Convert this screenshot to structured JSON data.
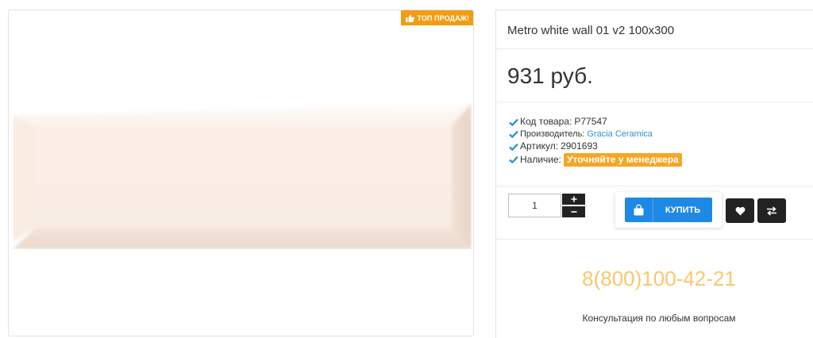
{
  "badge": {
    "label": "ТОП ПРОДАЖ!",
    "icon": "thumbs-up-icon",
    "color": "#f39c12"
  },
  "product": {
    "title": "Metro white wall 01 v2 100x300",
    "price": "931 руб."
  },
  "props": {
    "code_label": "Код товара:",
    "code_value": "P77547",
    "manufacturer_label": "Производитель:",
    "manufacturer_value": "Gracia Ceramica",
    "article_label": "Артикул:",
    "article_value": "2901693",
    "availability_label": "Наличие:",
    "availability_value": "Уточняйте у менеджера"
  },
  "cart": {
    "quantity": "1",
    "plus": "+",
    "minus": "−",
    "buy_label": "КУПИТЬ"
  },
  "contact": {
    "phone": "8(800)100-42-21",
    "note": "Консультация по любым вопросам"
  },
  "colors": {
    "accent": "#1e88e5",
    "badge": "#f39c12",
    "availability": "#f5a623",
    "phone": "#f9c86e",
    "link": "#2a93d5"
  }
}
